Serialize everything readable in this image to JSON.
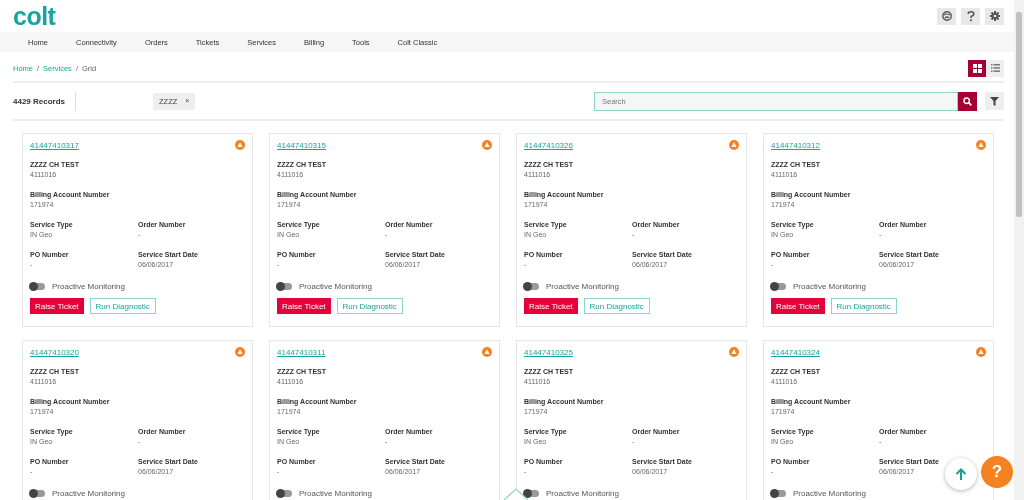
{
  "header": {
    "logo": "colt"
  },
  "nav": [
    {
      "label": "Home"
    },
    {
      "label": "Connectivity"
    },
    {
      "label": "Orders"
    },
    {
      "label": "Tickets"
    },
    {
      "label": "Services"
    },
    {
      "label": "Billing"
    },
    {
      "label": "Tools"
    },
    {
      "label": "Colt Classic"
    }
  ],
  "breadcrumb": [
    {
      "label": "Home",
      "link": true,
      "separator": "/"
    },
    {
      "label": "Services",
      "link": true,
      "separator": "/"
    },
    {
      "label": "Grid",
      "link": false
    }
  ],
  "views": [
    {
      "kind": "grid",
      "selected": true
    },
    {
      "kind": "list",
      "selected": false
    }
  ],
  "records": "4429 Records",
  "filter_chip": {
    "label": "ZZZZ",
    "remove": "×"
  },
  "search": {
    "placeholder": "Search"
  },
  "cards": [
    {
      "id": "41447410317",
      "customer": "ZZZZ CH TEST",
      "customer_no": "4111016",
      "fields": [
        {
          "label": "Billing Account Number",
          "value": "171974"
        },
        {
          "label": "Service Type",
          "value": "IN Geo"
        },
        {
          "label": "Order Number",
          "value": "-"
        },
        {
          "label": "PO Number",
          "value": "-"
        },
        {
          "label": "Service Start Date",
          "value": "06/06/2017"
        }
      ],
      "monitoring": {
        "label": "Proactive Monitoring",
        "on": false
      },
      "buttons": [
        {
          "label": "Raise Ticket",
          "kind": "primary"
        },
        {
          "label": "Run Diagnostic",
          "kind": "outline"
        }
      ]
    },
    {
      "id": "41447410315",
      "customer": "ZZZZ CH TEST",
      "customer_no": "4111016",
      "fields": [
        {
          "label": "Billing Account Number",
          "value": "171974"
        },
        {
          "label": "Service Type",
          "value": "IN Geo"
        },
        {
          "label": "Order Number",
          "value": "-"
        },
        {
          "label": "PO Number",
          "value": "-"
        },
        {
          "label": "Service Start Date",
          "value": "06/06/2017"
        }
      ],
      "monitoring": {
        "label": "Proactive Monitoring",
        "on": false
      },
      "buttons": [
        {
          "label": "Raise Ticket",
          "kind": "primary"
        },
        {
          "label": "Run Diagnostic",
          "kind": "outline"
        }
      ]
    },
    {
      "id": "41447410326",
      "customer": "ZZZZ CH TEST",
      "customer_no": "4111016",
      "fields": [
        {
          "label": "Billing Account Number",
          "value": "171974"
        },
        {
          "label": "Service Type",
          "value": "IN Geo"
        },
        {
          "label": "Order Number",
          "value": "-"
        },
        {
          "label": "PO Number",
          "value": "-"
        },
        {
          "label": "Service Start Date",
          "value": "06/06/2017"
        }
      ],
      "monitoring": {
        "label": "Proactive Monitoring",
        "on": false
      },
      "buttons": [
        {
          "label": "Raise Ticket",
          "kind": "primary"
        },
        {
          "label": "Run Diagnostic",
          "kind": "outline"
        }
      ]
    },
    {
      "id": "41447410312",
      "customer": "ZZZZ CH TEST",
      "customer_no": "4111016",
      "fields": [
        {
          "label": "Billing Account Number",
          "value": "171974"
        },
        {
          "label": "Service Type",
          "value": "IN Geo"
        },
        {
          "label": "Order Number",
          "value": "-"
        },
        {
          "label": "PO Number",
          "value": "-"
        },
        {
          "label": "Service Start Date",
          "value": "06/06/2017"
        }
      ],
      "monitoring": {
        "label": "Proactive Monitoring",
        "on": false
      },
      "buttons": [
        {
          "label": "Raise Ticket",
          "kind": "primary"
        },
        {
          "label": "Run Diagnostic",
          "kind": "outline"
        }
      ]
    },
    {
      "id": "41447410320",
      "customer": "ZZZZ CH TEST",
      "customer_no": "4111016",
      "fields": [
        {
          "label": "Billing Account Number",
          "value": "171974"
        },
        {
          "label": "Service Type",
          "value": "IN Geo"
        },
        {
          "label": "Order Number",
          "value": "-"
        },
        {
          "label": "PO Number",
          "value": "-"
        },
        {
          "label": "Service Start Date",
          "value": "06/06/2017"
        }
      ],
      "monitoring": {
        "label": "Proactive Monitoring",
        "on": false
      }
    },
    {
      "id": "41447410311",
      "customer": "ZZZZ CH TEST",
      "customer_no": "4111016",
      "fields": [
        {
          "label": "Billing Account Number",
          "value": "171974"
        },
        {
          "label": "Service Type",
          "value": "IN Geo"
        },
        {
          "label": "Order Number",
          "value": "-"
        },
        {
          "label": "PO Number",
          "value": "-"
        },
        {
          "label": "Service Start Date",
          "value": "06/06/2017"
        }
      ],
      "monitoring": {
        "label": "Proactive Monitoring",
        "on": false
      }
    },
    {
      "id": "41447410325",
      "customer": "ZZZZ CH TEST",
      "customer_no": "4111016",
      "fields": [
        {
          "label": "Billing Account Number",
          "value": "171974"
        },
        {
          "label": "Service Type",
          "value": "IN Geo"
        },
        {
          "label": "Order Number",
          "value": "-"
        },
        {
          "label": "PO Number",
          "value": "-"
        },
        {
          "label": "Service Start Date",
          "value": "06/06/2017"
        }
      ],
      "monitoring": {
        "label": "Proactive Monitoring",
        "on": false
      }
    },
    {
      "id": "41447410324",
      "customer": "ZZZZ CH TEST",
      "customer_no": "4111016",
      "fields": [
        {
          "label": "Billing Account Number",
          "value": "171974"
        },
        {
          "label": "Service Type",
          "value": "IN Geo"
        },
        {
          "label": "Order Number",
          "value": "-"
        },
        {
          "label": "PO Number",
          "value": "-"
        },
        {
          "label": "Service Start Date",
          "value": "06/06/2017"
        }
      ],
      "monitoring": {
        "label": "Proactive Monitoring",
        "on": false
      }
    }
  ],
  "help_button": {
    "label": "?"
  }
}
